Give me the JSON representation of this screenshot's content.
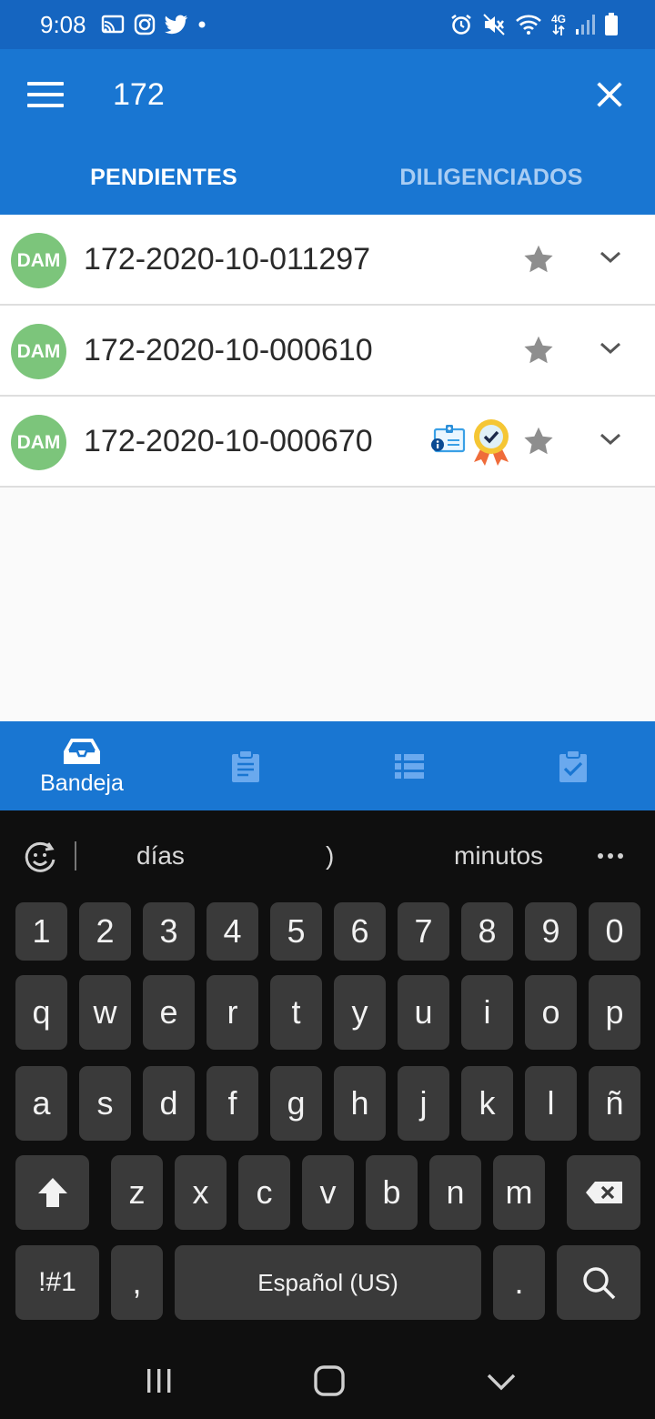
{
  "status_bar": {
    "time": "9:08",
    "left_icons": [
      "cast-icon",
      "instagram-icon",
      "twitter-icon",
      "dot-icon"
    ],
    "right_icons": [
      "alarm-icon",
      "mute-icon",
      "wifi-icon",
      "network-4g-icon",
      "signal-icon",
      "battery-icon"
    ],
    "network_label": "4G"
  },
  "app_bar": {
    "menu_icon": "menu-icon",
    "search_value": "172",
    "close_icon": "close-icon"
  },
  "tabs": [
    {
      "label": "PENDIENTES",
      "active": true
    },
    {
      "label": "DILIGENCIADOS",
      "active": false
    }
  ],
  "list": {
    "items": [
      {
        "avatar": "DAM",
        "title": "172-2020-10-011297",
        "extra_icons": []
      },
      {
        "avatar": "DAM",
        "title": "172-2020-10-000610",
        "extra_icons": []
      },
      {
        "avatar": "DAM",
        "title": "172-2020-10-000670",
        "extra_icons": [
          "id-card-info-icon",
          "award-badge-icon"
        ]
      }
    ]
  },
  "bottom_nav": {
    "items": [
      {
        "icon": "inbox-icon",
        "label": "Bandeja",
        "active": true
      },
      {
        "icon": "clipboard-icon",
        "label": "",
        "active": false
      },
      {
        "icon": "list-icon",
        "label": "",
        "active": false
      },
      {
        "icon": "clipboard-check-icon",
        "label": "",
        "active": false
      }
    ]
  },
  "keyboard": {
    "suggestions": [
      "días",
      ")",
      "minutos"
    ],
    "rows": [
      [
        "1",
        "2",
        "3",
        "4",
        "5",
        "6",
        "7",
        "8",
        "9",
        "0"
      ],
      [
        "q",
        "w",
        "e",
        "r",
        "t",
        "y",
        "u",
        "i",
        "o",
        "p"
      ],
      [
        "a",
        "s",
        "d",
        "f",
        "g",
        "h",
        "j",
        "k",
        "l",
        "ñ"
      ],
      [
        "z",
        "x",
        "c",
        "v",
        "b",
        "n",
        "m"
      ]
    ],
    "symbols_key": "!#1",
    "comma_key": ",",
    "space_key": "Español (US)",
    "period_key": "."
  },
  "colors": {
    "app_bar": "#1976d2",
    "status_bar": "#1565c0",
    "avatar": "#7cc57b",
    "inactive_tab": "#a9cdf3",
    "keyboard_bg": "#0f0f0f",
    "key_bg": "#3a3a3a"
  }
}
